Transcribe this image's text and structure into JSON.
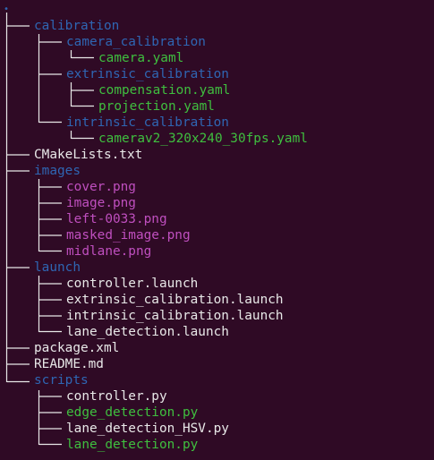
{
  "terminal": {
    "tree": [
      {
        "name": "calibration",
        "type": "dir"
      },
      {
        "name": "camera_calibration",
        "type": "dir"
      },
      {
        "name": "camera.yaml",
        "type": "yaml"
      },
      {
        "name": "extrinsic_calibration",
        "type": "dir"
      },
      {
        "name": "compensation.yaml",
        "type": "yaml"
      },
      {
        "name": "projection.yaml",
        "type": "yaml"
      },
      {
        "name": "intrinsic_calibration",
        "type": "dir"
      },
      {
        "name": "camerav2_320x240_30fps.yaml",
        "type": "yaml"
      },
      {
        "name": "CMakeLists.txt",
        "type": "file"
      },
      {
        "name": "images",
        "type": "dir"
      },
      {
        "name": "cover.png",
        "type": "png"
      },
      {
        "name": "image.png",
        "type": "png"
      },
      {
        "name": "left-0033.png",
        "type": "png"
      },
      {
        "name": "masked_image.png",
        "type": "png"
      },
      {
        "name": "midlane.png",
        "type": "png"
      },
      {
        "name": "launch",
        "type": "dir"
      },
      {
        "name": "controller.launch",
        "type": "file"
      },
      {
        "name": "extrinsic_calibration.launch",
        "type": "file"
      },
      {
        "name": "intrinsic_calibration.launch",
        "type": "file"
      },
      {
        "name": "lane_detection.launch",
        "type": "file"
      },
      {
        "name": "package.xml",
        "type": "file"
      },
      {
        "name": "README.md",
        "type": "file"
      },
      {
        "name": "scripts",
        "type": "dir"
      },
      {
        "name": "controller.py",
        "type": "file"
      },
      {
        "name": "edge_detection.py",
        "type": "exec"
      },
      {
        "name": "lane_detection_HSV.py",
        "type": "file"
      },
      {
        "name": "lane_detection.py",
        "type": "exec"
      }
    ]
  },
  "colors": {
    "background": "#2f0a25",
    "directory": "#2f66b3",
    "yaml": "#3fbf3f",
    "png": "#bf4fbf",
    "executable": "#3fbf3f",
    "regular": "#e8e8e8",
    "tree_lines": "#e8e8e8"
  }
}
